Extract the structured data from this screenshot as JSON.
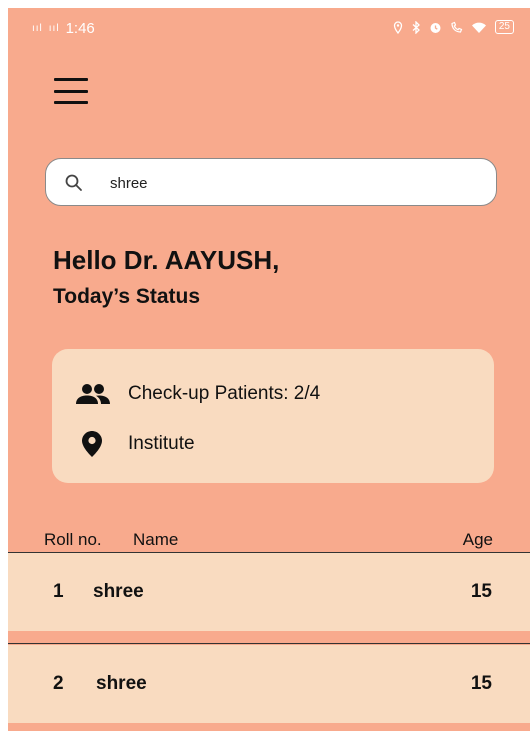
{
  "status_bar": {
    "signal_1": "ııl",
    "signal_2": "ııl",
    "time": "1:46",
    "icons": [
      "location-icon",
      "bluetooth-icon",
      "alarm-icon",
      "call-icon",
      "wifi-icon"
    ],
    "battery": "25"
  },
  "header": {
    "menu_icon": "menu-icon"
  },
  "search": {
    "value": "shree",
    "placeholder": ""
  },
  "greeting": {
    "title": "Hello Dr. AAYUSH,",
    "subtitle": "Today’s Status"
  },
  "status_card": {
    "patients_label": "Check-up Patients:  2/4",
    "location_label": "Institute"
  },
  "table": {
    "headers": {
      "roll": "Roll no.",
      "name": "Name",
      "age": "Age"
    },
    "rows": [
      {
        "roll": "1",
        "name": "shree",
        "age": "15"
      },
      {
        "roll": "2",
        "name": "shree",
        "age": "15"
      }
    ]
  },
  "colors": {
    "background": "#f8aa8d",
    "card": "#f9dbc0",
    "text": "#111111"
  }
}
